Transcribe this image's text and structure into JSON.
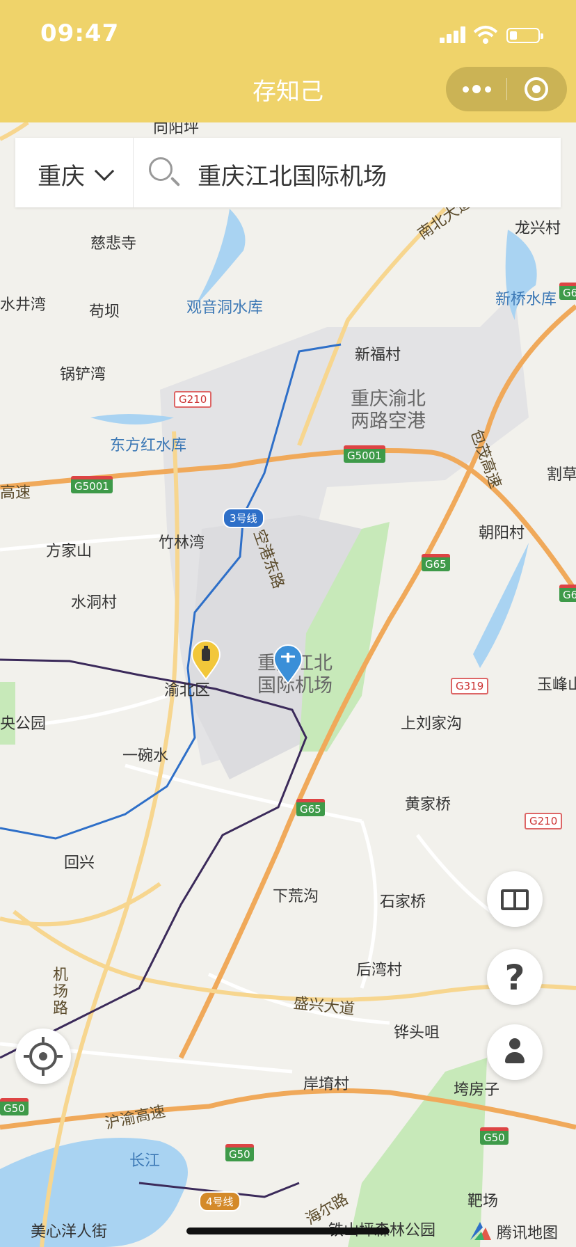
{
  "status_bar": {
    "time": "09:47"
  },
  "nav": {
    "title": "存知己"
  },
  "search": {
    "city": "重庆",
    "query": "重庆江北国际机场"
  },
  "map_labels": [
    "向阳坪",
    "慈悲寺",
    "水井湾",
    "苟坝",
    "观音洞水库",
    "锅铲湾",
    "东方红水库",
    "新福村",
    "龙兴村",
    "新桥水库",
    "重庆渝北两路空港",
    "竹林湾",
    "方家山",
    "水洞村",
    "空港东路",
    "朝阳村",
    "割草",
    "高速",
    "重庆江北国际机场",
    "渝北区",
    "央公园",
    "一碗水",
    "上刘家沟",
    "黄家桥",
    "玉峰山",
    "回兴",
    "下荒沟",
    "石家桥",
    "后湾村",
    "机场路",
    "盛兴大道",
    "铧头咀",
    "岸堉村",
    "垮房子",
    "沪渝高速",
    "长江",
    "海尔路",
    "铁山坪森林公园",
    "美心洋人街",
    "靶场",
    "南北大道",
    "包茂高速"
  ],
  "road_shields": [
    "G210",
    "G5001",
    "G5001",
    "G65",
    "G65",
    "G319",
    "G65",
    "G210",
    "G50",
    "G50",
    "G65",
    "G50",
    "G65"
  ],
  "metro_badges": [
    "3号线",
    "4号线"
  ],
  "buttons": {
    "guide_icon": "book-icon",
    "help_label": "?",
    "user_icon": "user-icon",
    "locate_icon": "locate-icon"
  },
  "brand": {
    "name": "腾讯地图"
  },
  "colors": {
    "nav_bg": "#efd36a",
    "metro_line3": "#2e6fc8",
    "metro_line_purple": "#3b2a5a",
    "highway": "#f0a95a",
    "water": "#a9d3f2",
    "park": "#c7e9b9"
  }
}
